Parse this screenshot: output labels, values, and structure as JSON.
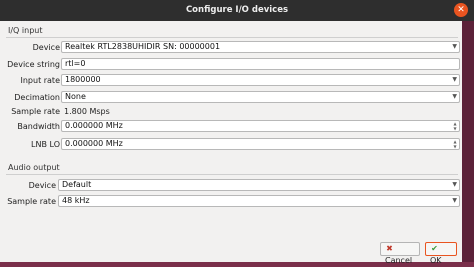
{
  "window": {
    "title": "Configure I/O devices",
    "close_glyph": "✕"
  },
  "iq": {
    "section_title": "I/Q input",
    "device_label": "Device",
    "device_value": "Realtek RTL2838UHIDIR SN: 00000001",
    "device_string_label": "Device string",
    "device_string_value": "rtl=0",
    "input_rate_label": "Input rate",
    "input_rate_value": "1800000",
    "decimation_label": "Decimation",
    "decimation_value": "None",
    "sample_rate_label": "Sample rate",
    "sample_rate_value": "1.800 Msps",
    "bandwidth_label": "Bandwidth",
    "bandwidth_value": "0.000000 MHz",
    "lnb_label": "LNB LO",
    "lnb_value": "0.000000 MHz"
  },
  "audio": {
    "section_title": "Audio output",
    "device_label": "Device",
    "device_value": "Default",
    "sample_rate_label": "Sample rate",
    "sample_rate_value": "48 kHz"
  },
  "buttons": {
    "cancel_label": "Cancel",
    "ok_label": "OK"
  },
  "icons": {
    "dropdown": "chevron-down-icon",
    "cancel": "cancel-icon",
    "ok": "check-icon"
  }
}
